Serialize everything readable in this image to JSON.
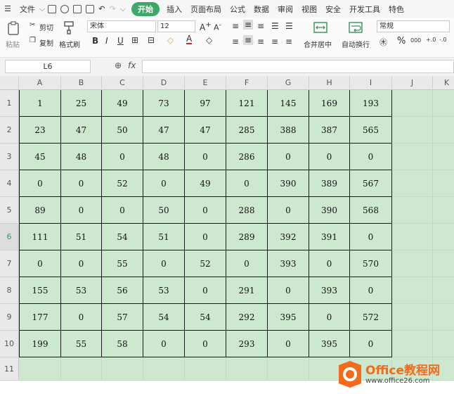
{
  "menu": {
    "file": "文件",
    "tabs": [
      "开始",
      "插入",
      "页面布局",
      "公式",
      "数据",
      "审阅",
      "视图",
      "安全",
      "开发工具",
      "特色"
    ]
  },
  "ribbon": {
    "paste": "粘贴",
    "cut": "剪切",
    "copy": "复制",
    "format_painter": "格式刷",
    "font_name": "宋体",
    "font_size": "12",
    "merge_center": "合并居中",
    "auto_wrap": "自动换行",
    "number_format": "常规",
    "percent": "%",
    "thousands": "000"
  },
  "formula_bar": {
    "name_box": "L6",
    "fx": "fx",
    "value": ""
  },
  "sheet": {
    "columns": [
      "A",
      "B",
      "C",
      "D",
      "E",
      "F",
      "G",
      "H",
      "I",
      "J",
      "K"
    ],
    "rows": [
      "1",
      "2",
      "3",
      "4",
      "5",
      "6",
      "7",
      "8",
      "9",
      "10",
      "11"
    ],
    "selected_row": "6",
    "data": [
      [
        "1",
        "25",
        "49",
        "73",
        "97",
        "121",
        "145",
        "169",
        "193"
      ],
      [
        "23",
        "47",
        "50",
        "47",
        "47",
        "285",
        "388",
        "387",
        "565"
      ],
      [
        "45",
        "48",
        "0",
        "48",
        "0",
        "286",
        "0",
        "0",
        "0"
      ],
      [
        "0",
        "0",
        "52",
        "0",
        "49",
        "0",
        "390",
        "389",
        "567"
      ],
      [
        "89",
        "0",
        "0",
        "50",
        "0",
        "288",
        "0",
        "390",
        "568"
      ],
      [
        "111",
        "51",
        "54",
        "51",
        "0",
        "289",
        "392",
        "391",
        "0"
      ],
      [
        "0",
        "0",
        "55",
        "0",
        "52",
        "0",
        "393",
        "0",
        "570"
      ],
      [
        "155",
        "53",
        "56",
        "53",
        "0",
        "291",
        "0",
        "393",
        "0"
      ],
      [
        "177",
        "0",
        "57",
        "54",
        "54",
        "292",
        "395",
        "0",
        "572"
      ],
      [
        "199",
        "55",
        "58",
        "0",
        "0",
        "293",
        "0",
        "395",
        "0"
      ]
    ]
  },
  "watermark": {
    "brand": "Office教程网",
    "url": "www.office26.com"
  },
  "colors": {
    "cell_fill": "#cce8cf",
    "accent": "#3ea868",
    "logo_orange": "#f26b1d"
  }
}
